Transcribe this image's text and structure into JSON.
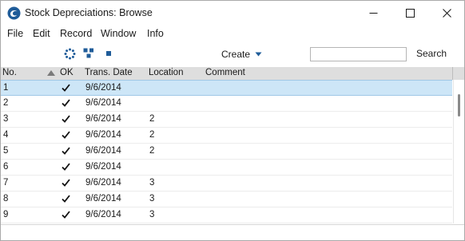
{
  "window": {
    "title": "Stock Depreciations: Browse",
    "icon": "app-swirl-icon",
    "controls": [
      "minimize-icon",
      "maximize-icon",
      "close-icon"
    ]
  },
  "menu": [
    "File",
    "Edit",
    "Record",
    "Window",
    "Info"
  ],
  "toolbar": {
    "icons": [
      "refresh-icon",
      "hierarchy-icon",
      "square-icon"
    ],
    "create_label": "Create",
    "search_value": "",
    "search_label": "Search"
  },
  "columns": [
    "No.",
    "OK",
    "Trans. Date",
    "Location",
    "Comment"
  ],
  "sort": {
    "column": "No.",
    "direction": "ascending"
  },
  "rows": [
    {
      "no": "1",
      "ok": true,
      "date": "9/6/2014",
      "location": "",
      "comment": ""
    },
    {
      "no": "2",
      "ok": true,
      "date": "9/6/2014",
      "location": "",
      "comment": ""
    },
    {
      "no": "3",
      "ok": true,
      "date": "9/6/2014",
      "location": "2",
      "comment": ""
    },
    {
      "no": "4",
      "ok": true,
      "date": "9/6/2014",
      "location": "2",
      "comment": ""
    },
    {
      "no": "5",
      "ok": true,
      "date": "9/6/2014",
      "location": "2",
      "comment": ""
    },
    {
      "no": "6",
      "ok": true,
      "date": "9/6/2014",
      "location": "",
      "comment": ""
    },
    {
      "no": "7",
      "ok": true,
      "date": "9/6/2014",
      "location": "3",
      "comment": ""
    },
    {
      "no": "8",
      "ok": true,
      "date": "9/6/2014",
      "location": "3",
      "comment": ""
    },
    {
      "no": "9",
      "ok": true,
      "date": "9/6/2014",
      "location": "3",
      "comment": ""
    }
  ],
  "selected_row": "1",
  "colors": {
    "selection": "#cde6f7",
    "header": "#dedede",
    "accent": "#1f5c99"
  }
}
